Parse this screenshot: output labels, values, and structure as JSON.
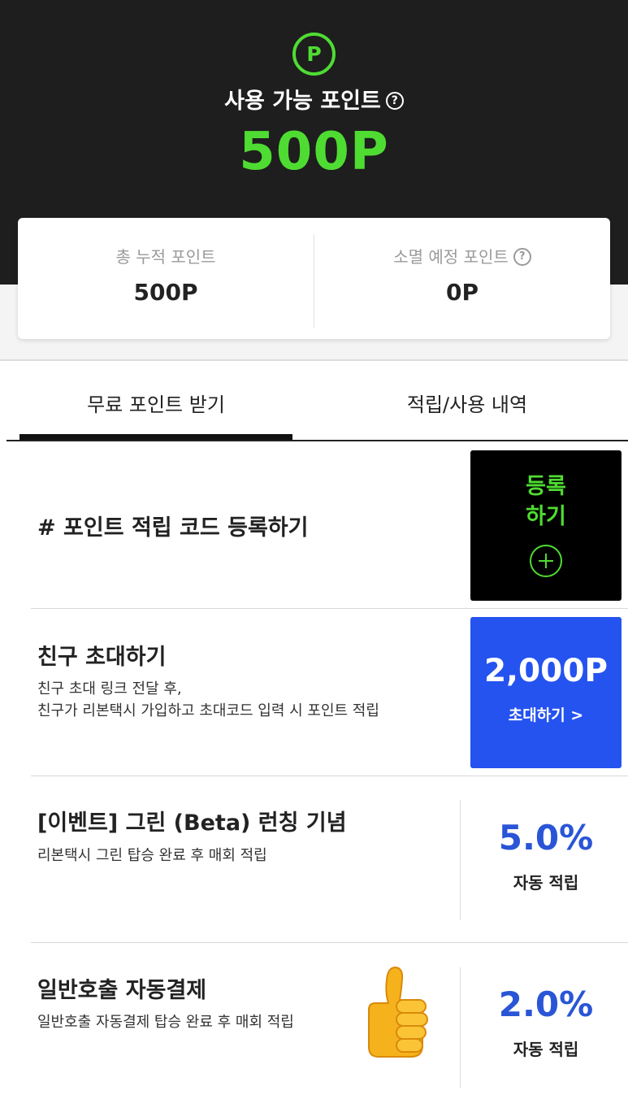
{
  "header": {
    "point_symbol": "P",
    "title": "사용 가능 포인트",
    "help_symbol": "?",
    "amount": "500P"
  },
  "summary": {
    "total": {
      "label": "총 누적 포인트",
      "value": "500P"
    },
    "expiring": {
      "label": "소멸 예정 포인트",
      "help_symbol": "?",
      "value": "0P"
    }
  },
  "tabs": [
    {
      "label": "무료 포인트 받기",
      "active": true
    },
    {
      "label": "적립/사용 내역",
      "active": false
    }
  ],
  "items": {
    "code": {
      "title": "# 포인트 적립 코드 등록하기",
      "button_line1": "등록",
      "button_line2": "하기"
    },
    "invite": {
      "title": "친구 초대하기",
      "desc_line1": "친구 초대 링크 전달 후,",
      "desc_line2": "친구가 리본택시 가입하고 초대코드 입력 시 포인트 적립",
      "points": "2,000P",
      "button": "초대하기 >"
    },
    "event": {
      "title": "[이벤트] 그린 (Beta) 런칭 기념",
      "desc": "리본택시 그린 탑승 완료 후 매회 적립",
      "rate": "5.0%",
      "rate_label": "자동 적립"
    },
    "autopay": {
      "title": "일반호출 자동결제",
      "desc": "일반호출 자동결제 탑승 완료 후 매회 적립",
      "rate": "2.0%",
      "rate_label": "자동 적립",
      "icon": "thumbs-up-icon"
    }
  },
  "colors": {
    "accent_green": "#4fdc32",
    "invite_blue": "#2553ef",
    "rate_blue": "#2a55d6",
    "header_bg": "#1e1e1e"
  }
}
